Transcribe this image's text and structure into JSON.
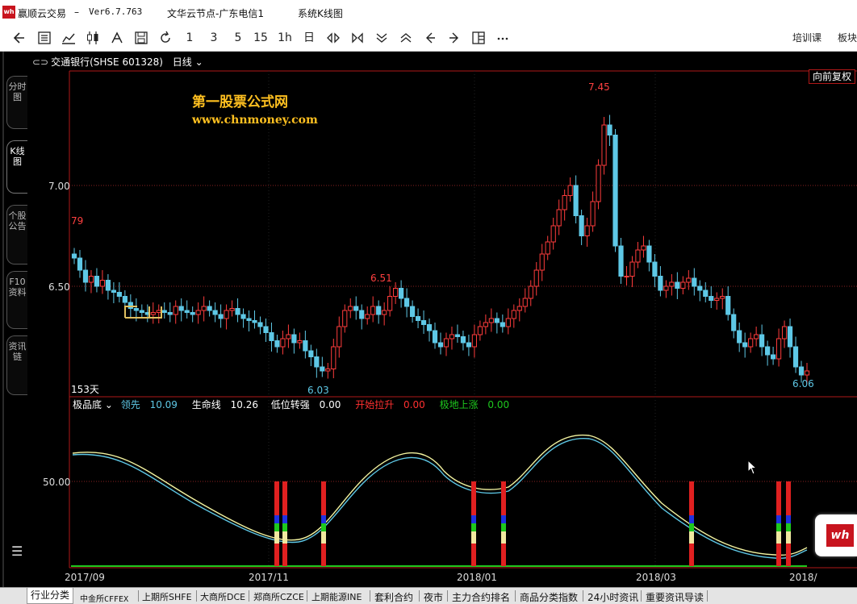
{
  "titlebar": {
    "logo": "wh",
    "app": "赢顺云交易",
    "dash": "–",
    "version": "Ver6.7.763",
    "server": "文华云节点-广东电信1",
    "view": "系统K线图"
  },
  "toolbar": {
    "buttons": [
      "back-icon",
      "list-icon",
      "line-chart-icon",
      "kline-icon",
      "formula-icon",
      "save-icon",
      "refresh-icon"
    ],
    "periods": [
      "1",
      "3",
      "5",
      "15",
      "1h",
      "日"
    ],
    "right": [
      "培训课",
      "板块"
    ]
  },
  "symbol": {
    "name": "交通银行(SHSE 601328)",
    "period": "日线"
  },
  "adjust_label": "向前复权",
  "watermark": {
    "title": "第一股票公式网",
    "url": "www.chnmoney.com"
  },
  "sidebar": [
    "分时图",
    "K线图",
    "个股公告",
    "F10资料",
    "资讯链"
  ],
  "days_label": "153天",
  "indicator": {
    "name": "极品底",
    "items": [
      {
        "label": "领先",
        "value": "10.09",
        "color": "#5ec8e6"
      },
      {
        "label": "生命线",
        "value": "10.26",
        "color": "#ffffff"
      },
      {
        "label": "低位转强",
        "value": "0.00",
        "color": "#ffffff"
      },
      {
        "label": "开始拉升",
        "value": "0.00",
        "color": "#ff3030"
      },
      {
        "label": "极地上涨",
        "value": "0.00",
        "color": "#1ec81e"
      }
    ]
  },
  "bottom_tabs": [
    "行业分类",
    "中金所CFFEX",
    "上期所SHFE",
    "大商所DCE",
    "郑商所CZCE",
    "上期能源INE",
    "套利合约",
    "夜市",
    "主力合约排名",
    "商品分类指数",
    "24小时资讯",
    "重要资讯导读"
  ],
  "chart_data": {
    "type": "candlestick",
    "price_ticks": [
      "7.00",
      "6.50"
    ],
    "indicator_ticks": [
      "50.00"
    ],
    "x_ticks": [
      "2017/09",
      "2017/11",
      "2018/01",
      "2018/03",
      "2018/"
    ],
    "annotations": [
      {
        "label": "7.45",
        "role": "high",
        "color": "#ff4040"
      },
      {
        "label": "6.51",
        "role": "local high",
        "color": "#ff4040"
      },
      {
        "label": "6.03",
        "role": "low",
        "color": "#5ec8e6"
      },
      {
        "label": "6.06",
        "role": "low",
        "color": "#5ec8e6"
      },
      {
        "label": "79",
        "role": "left edge high (truncated)",
        "color": "#ff4040"
      }
    ],
    "closes": [
      6.64,
      6.58,
      6.52,
      6.55,
      6.5,
      6.53,
      6.48,
      6.47,
      6.45,
      6.42,
      6.39,
      6.38,
      6.37,
      6.36,
      6.37,
      6.38,
      6.37,
      6.36,
      6.4,
      6.38,
      6.37,
      6.36,
      6.38,
      6.4,
      6.38,
      6.36,
      6.34,
      6.38,
      6.39,
      6.36,
      6.34,
      6.33,
      6.32,
      6.3,
      6.27,
      6.23,
      6.2,
      6.24,
      6.26,
      6.22,
      6.23,
      6.18,
      6.15,
      6.1,
      6.08,
      6.09,
      6.2,
      6.3,
      6.38,
      6.4,
      6.38,
      6.34,
      6.36,
      6.4,
      6.36,
      6.38,
      6.45,
      6.49,
      6.44,
      6.4,
      6.35,
      6.33,
      6.31,
      6.28,
      6.22,
      6.2,
      6.24,
      6.26,
      6.25,
      6.22,
      6.2,
      6.26,
      6.3,
      6.32,
      6.34,
      6.32,
      6.3,
      6.34,
      6.38,
      6.4,
      6.44,
      6.5,
      6.58,
      6.66,
      6.72,
      6.8,
      6.88,
      6.95,
      7.0,
      6.85,
      6.75,
      6.8,
      6.92,
      7.1,
      7.3,
      7.25,
      6.7,
      6.55,
      6.55,
      6.62,
      6.68,
      6.7,
      6.62,
      6.55,
      6.48,
      6.5,
      6.52,
      6.49,
      6.52,
      6.54,
      6.5,
      6.48,
      6.45,
      6.43,
      6.44,
      6.45,
      6.36,
      6.28,
      6.22,
      6.2,
      6.24,
      6.26,
      6.2,
      6.16,
      6.14,
      6.24,
      6.3,
      6.2,
      6.1,
      6.06,
      6.08
    ]
  }
}
